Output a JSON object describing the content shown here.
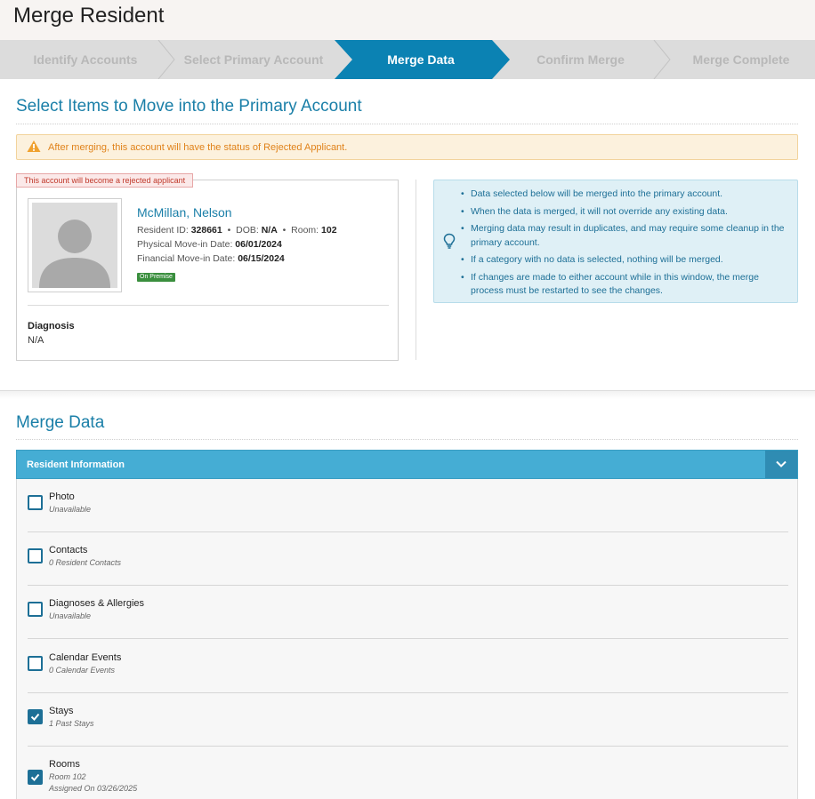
{
  "page": {
    "title": "Merge Resident"
  },
  "wizard": {
    "steps": [
      {
        "label": "Identify Accounts",
        "state": "inactive"
      },
      {
        "label": "Select Primary Account",
        "state": "inactive"
      },
      {
        "label": "Merge Data",
        "state": "active"
      },
      {
        "label": "Confirm Merge",
        "state": "inactive"
      },
      {
        "label": "Merge Complete",
        "state": "inactive"
      }
    ]
  },
  "select_section": {
    "title": "Select Items to Move into the Primary Account"
  },
  "warning": {
    "icon": "warning-triangle-icon",
    "text": "After merging, this account will have the status of Rejected Applicant."
  },
  "resident": {
    "reject_tag": "This account will become a rejected applicant",
    "name": "McMillan, Nelson",
    "resident_id_label": "Resident ID:",
    "resident_id": "328661",
    "dob_label": "DOB:",
    "dob": "N/A",
    "room_label": "Room:",
    "room": "102",
    "physical_label": "Physical Move-in Date:",
    "physical_date": "06/01/2024",
    "financial_label": "Financial Move-in Date:",
    "financial_date": "06/15/2024",
    "badge": "On Premise",
    "diagnosis_label": "Diagnosis",
    "diagnosis_value": "N/A"
  },
  "info": {
    "icon": "lightbulb-icon",
    "items": [
      "Data selected below will be merged into the primary account.",
      "When the data is merged, it will not override any existing data.",
      "Merging data may result in duplicates, and may require some cleanup in the primary account.",
      "If a category with no data is selected, nothing will be merged.",
      "If changes are made to either account while in this window, the merge process must be restarted to see the changes."
    ]
  },
  "merge_section": {
    "title": "Merge Data"
  },
  "accordion": {
    "title": "Resident Information",
    "toggle_icon": "chevron-down-icon",
    "items": [
      {
        "label": "Photo",
        "sub": "Unavailable",
        "sub2": "",
        "checked": false
      },
      {
        "label": "Contacts",
        "sub": "0 Resident Contacts",
        "sub2": "",
        "checked": false
      },
      {
        "label": "Diagnoses & Allergies",
        "sub": "Unavailable",
        "sub2": "",
        "checked": false
      },
      {
        "label": "Calendar Events",
        "sub": "0 Calendar Events",
        "sub2": "",
        "checked": false
      },
      {
        "label": "Stays",
        "sub": "1 Past Stays",
        "sub2": "",
        "checked": true
      },
      {
        "label": "Rooms",
        "sub": "Room 102",
        "sub2": "Assigned On 03/26/2025",
        "checked": true
      }
    ]
  },
  "colors": {
    "accent": "#1a7fa8",
    "active_step": "#0b82b3",
    "accordion_header": "#45add4",
    "warning_text": "#e0821a",
    "badge_green": "#3a8f3e"
  }
}
